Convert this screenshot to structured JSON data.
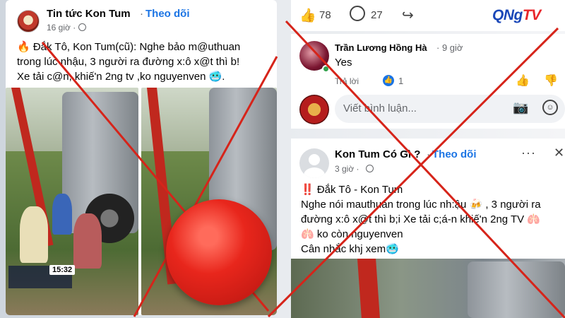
{
  "left_post": {
    "page_name": "Tin tức Kon Tum",
    "separator": "·",
    "follow_label": "Theo dõi",
    "time": "16 giờ ·",
    "lines": [
      "🔥 Đắk Tô, Kon Tum(cũ): Nghe bảo m@uthuan",
      "trong lúc nhậu, 3 người ra đường x:ô x@t thì b!",
      "Xe tải c@n, khiế'n 2ng tv ,ko nguyenven 🥶."
    ],
    "video_clock": "15:32"
  },
  "reactions": {
    "like_icon": "👍",
    "likes": "78",
    "comments": "27",
    "share_icon": "↪"
  },
  "comment": {
    "author": "Trần Lương Hồng Hà",
    "time": "· 9 giờ",
    "text": "Yes",
    "reply_label": "Trả lời",
    "like_count": "1"
  },
  "composer": {
    "placeholder": "Viết bình luận...",
    "camera_icon": "📷",
    "emoji_icon": "☺"
  },
  "right_post": {
    "page_name": "Kon Tum Có Gì ?",
    "separator": "·",
    "follow_label": "Theo dõi",
    "more_label": "···",
    "close_label": "✕",
    "time": "3 giờ ·",
    "lines": [
      "‼️ Đắk Tô - Kon Tum",
      "Nghe nói mauthuan trong lúc nh:ậu 🍻 , 3 người ra",
      "đường x:ô x@t thì b;i Xe tải c;á-n khiế'n 2ng TV 🫁",
      "🫁 ko còn nguyenven",
      "Cân nhắc khj xem🥶"
    ]
  },
  "logo": {
    "main": "QNg",
    "accent": "TV"
  },
  "colors": {
    "facebook_blue": "#1b74e4",
    "warning_red": "#e8261c"
  }
}
